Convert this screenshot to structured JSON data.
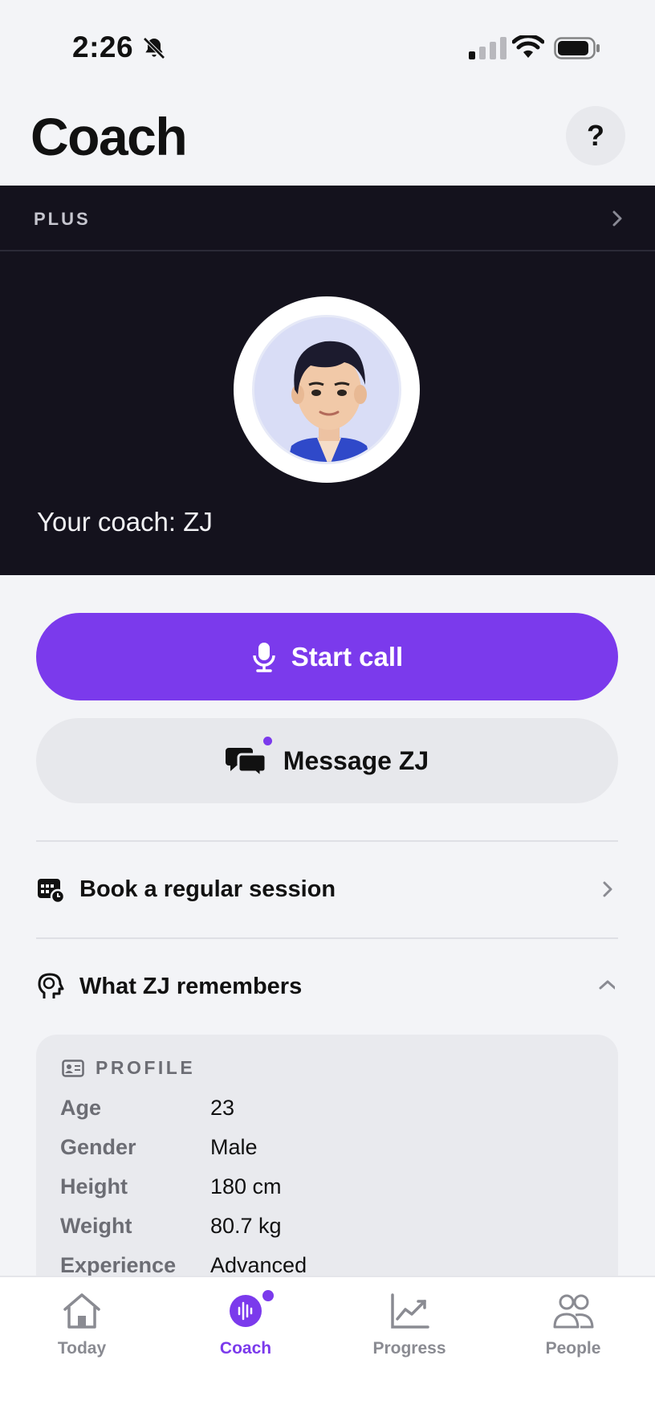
{
  "status_bar": {
    "time": "2:26"
  },
  "header": {
    "title": "Coach",
    "help_label": "?"
  },
  "plan": {
    "label": "PLUS"
  },
  "coach": {
    "name_line": "Your coach: ZJ"
  },
  "actions": {
    "start_call": "Start call",
    "message": "Message ZJ"
  },
  "rows": {
    "book_session": "Book a regular session",
    "remembers": "What ZJ remembers"
  },
  "profile": {
    "title": "PROFILE",
    "fields": [
      {
        "label": "Age",
        "value": "23"
      },
      {
        "label": "Gender",
        "value": "Male"
      },
      {
        "label": "Height",
        "value": "180 cm"
      },
      {
        "label": "Weight",
        "value": "80.7 kg"
      },
      {
        "label": "Experience",
        "value": "Advanced"
      }
    ]
  },
  "tabs": [
    {
      "label": "Today",
      "icon": "home-icon"
    },
    {
      "label": "Coach",
      "icon": "coach-voice-icon",
      "active": true
    },
    {
      "label": "Progress",
      "icon": "chart-icon"
    },
    {
      "label": "People",
      "icon": "people-icon"
    }
  ],
  "colors": {
    "accent": "#7b3aec",
    "hero_bg": "#14121d",
    "page_bg": "#f3f4f7"
  }
}
